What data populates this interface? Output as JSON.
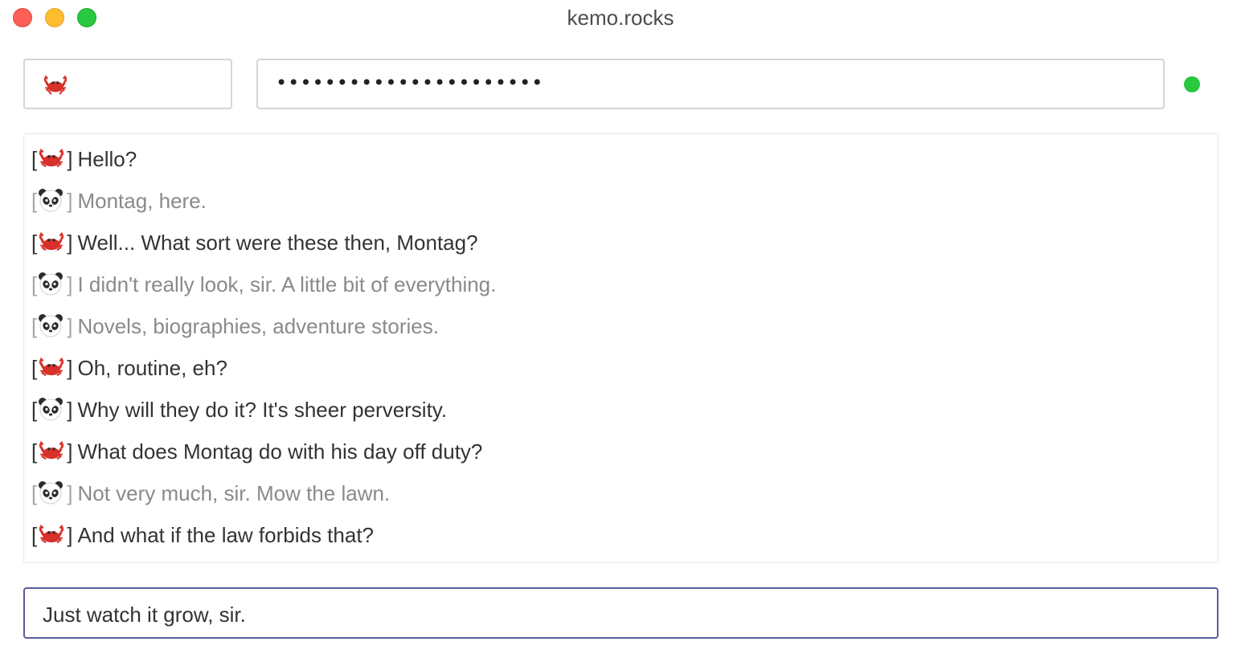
{
  "window": {
    "title": "kemo.rocks"
  },
  "login": {
    "username_avatar": "crab-icon",
    "password_value": "••••••••••••••••••••••",
    "status_color": "#28c840"
  },
  "messages": [
    {
      "author": "crab-icon",
      "self": true,
      "text": "Hello?"
    },
    {
      "author": "panda-icon",
      "self": false,
      "text": "Montag, here."
    },
    {
      "author": "crab-icon",
      "self": true,
      "text": "Well... What sort were these then, Montag?"
    },
    {
      "author": "panda-icon",
      "self": false,
      "text": "I didn't really look, sir. A little bit of everything."
    },
    {
      "author": "panda-icon",
      "self": false,
      "text": "Novels, biographies, adventure stories."
    },
    {
      "author": "crab-icon",
      "self": true,
      "text": "Oh, routine, eh?"
    },
    {
      "author": "panda-icon",
      "self": true,
      "text": "Why will they do it? It's sheer perversity."
    },
    {
      "author": "crab-icon",
      "self": true,
      "text": "What does Montag do with his day off duty?"
    },
    {
      "author": "panda-icon",
      "self": false,
      "text": "Not very much, sir. Mow the lawn."
    },
    {
      "author": "crab-icon",
      "self": true,
      "text": "And what if the law forbids that?"
    }
  ],
  "compose": {
    "value": "Just watch it grow, sir."
  },
  "colors": {
    "accent_border": "#5b5b9c",
    "crab": "#d8302a",
    "panda_dark": "#2b2b2b"
  }
}
